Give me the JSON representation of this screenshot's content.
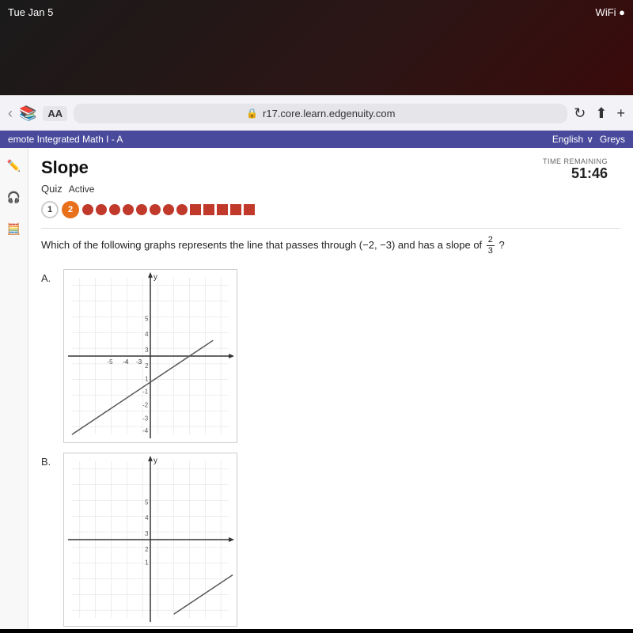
{
  "statusBar": {
    "date": "Tue Jan 5",
    "wifi": "WiFi",
    "battery": "●"
  },
  "browser": {
    "backLabel": "‹",
    "bookIcon": "📖",
    "aaLabel": "AA",
    "urlLock": "🔒",
    "urlText": "r17.core.learn.edgenuity.com",
    "refreshIcon": "↻",
    "shareIcon": "⬆",
    "newTabIcon": "+"
  },
  "tabBar": {
    "courseLabel": "emote Integrated Math I - A",
    "langLabel": "English",
    "chevron": "∨",
    "userLabel": "Greys"
  },
  "quiz": {
    "title": "Slope",
    "typeLabel": "Quiz",
    "statusLabel": "Active",
    "questions": [
      {
        "num": "1",
        "type": "white"
      },
      {
        "num": "2",
        "type": "orange"
      }
    ],
    "timerLabel": "TIME REMAINING",
    "timerValue": "51:46"
  },
  "question": {
    "text": "Which of the following graphs represents the line that passes through (−2, −3) and has a slope of",
    "fractionNum": "2",
    "fractionDen": "3",
    "questionMark": "?"
  },
  "answers": [
    {
      "label": "A."
    },
    {
      "label": "B."
    }
  ]
}
